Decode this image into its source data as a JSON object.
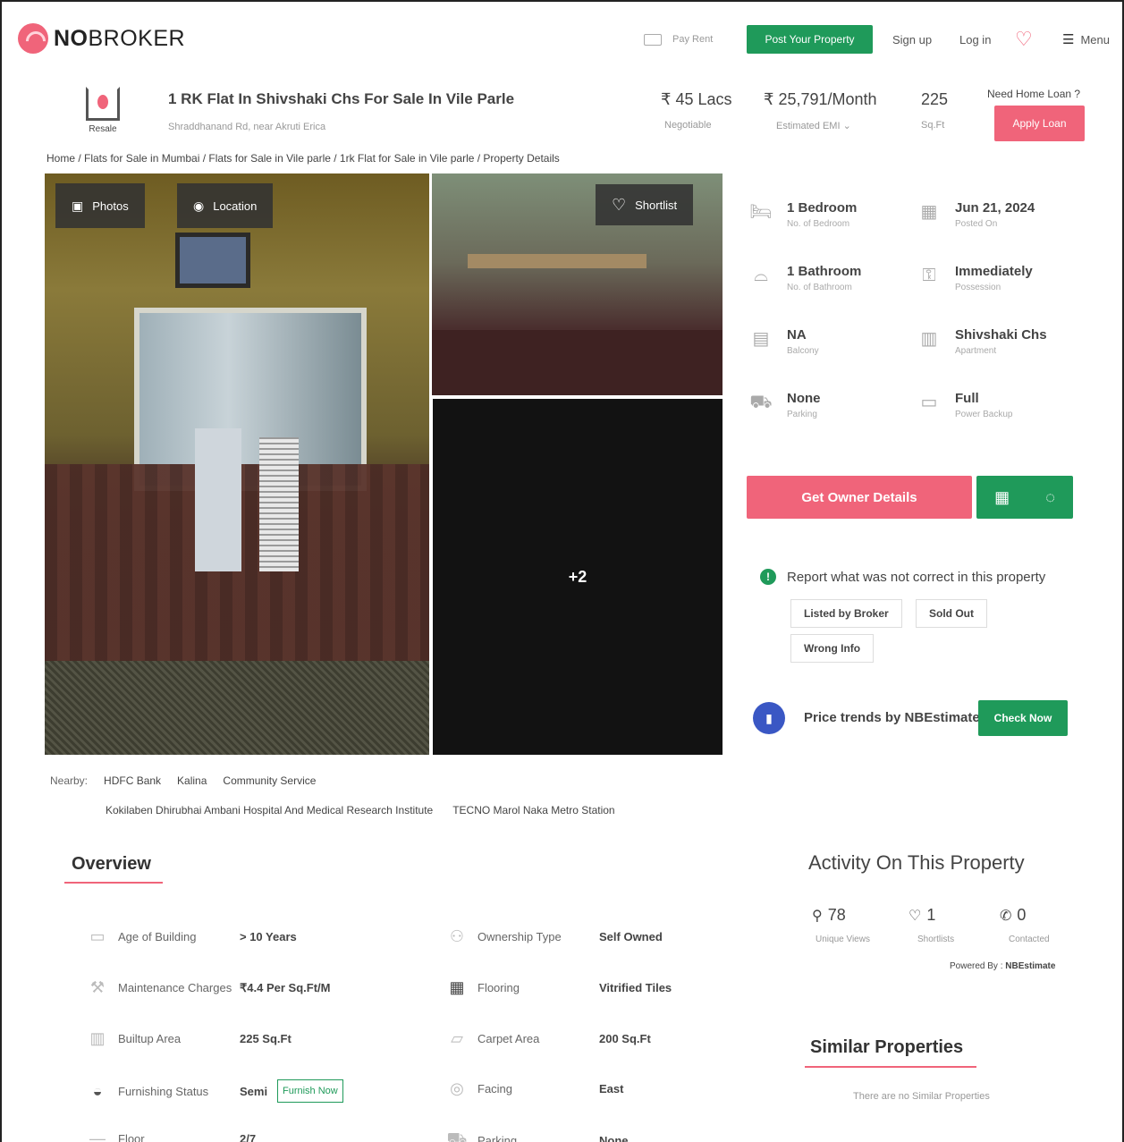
{
  "header": {
    "logo": {
      "bold": "NO",
      "rest": "BROKER"
    },
    "pay_rent": "Pay Rent",
    "post_property": "Post Your Property",
    "sign_up": "Sign up",
    "log_in": "Log in",
    "menu": "Menu"
  },
  "summary": {
    "badge": "Resale",
    "title": "1 RK Flat In Shivshaki Chs For Sale In Vile Parle",
    "address": "Shraddhanand Rd, near Akruti Erica",
    "price": "₹ 45 Lacs",
    "price_note": "Negotiable",
    "emi": "₹ 25,791/Month",
    "emi_note": "Estimated EMI",
    "area": "225",
    "area_note": "Sq.Ft",
    "loan_question": "Need Home Loan ?",
    "loan_button": "Apply Loan"
  },
  "breadcrumb": "Home / Flats for Sale in Mumbai / Flats for Sale in Vile parle / 1rk Flat for Sale in Vile parle / Property Details",
  "gallery": {
    "photos_label": "Photos",
    "location_label": "Location",
    "shortlist_label": "Shortlist",
    "more_count": "+2"
  },
  "specs": [
    {
      "icon": "bed-icon",
      "value": "1 Bedroom",
      "label": "No. of Bedroom"
    },
    {
      "icon": "calendar-icon",
      "value": "Jun 21, 2024",
      "label": "Posted On"
    },
    {
      "icon": "bath-icon",
      "value": "1 Bathroom",
      "label": "No. of Bathroom"
    },
    {
      "icon": "key-icon",
      "value": "Immediately",
      "label": "Possession"
    },
    {
      "icon": "balcony-icon",
      "value": "NA",
      "label": "Balcony"
    },
    {
      "icon": "building-icon",
      "value": "Shivshaki Chs",
      "label": "Apartment"
    },
    {
      "icon": "car-icon",
      "value": "None",
      "label": "Parking"
    },
    {
      "icon": "battery-icon",
      "value": "Full",
      "label": "Power Backup"
    }
  ],
  "owner_button": "Get Owner Details",
  "report": {
    "text": "Report what was not correct in this property",
    "tags": [
      "Listed by Broker",
      "Sold Out",
      "Wrong Info"
    ]
  },
  "price_trends": {
    "text": "Price trends by NBEstimate",
    "button": "Check Now"
  },
  "nearby": {
    "label": "Nearby:",
    "places": [
      "HDFC Bank",
      "Kalina",
      "Community Service",
      "Kokilaben Dhirubhai Ambani Hospital And Medical Research Institute",
      "TECNO Marol Naka Metro Station"
    ]
  },
  "overview": {
    "title": "Overview",
    "rows": [
      {
        "label": "Age of Building",
        "value": "> 10 Years",
        "label2": "Ownership Type",
        "value2": "Self Owned"
      },
      {
        "label": "Maintenance Charges",
        "value": "₹4.4 Per Sq.Ft/M",
        "label2": "Flooring",
        "value2": "Vitrified Tiles"
      },
      {
        "label": "Builtup Area",
        "value": "225 Sq.Ft",
        "label2": "Carpet Area",
        "value2": "200 Sq.Ft"
      },
      {
        "label": "Furnishing Status",
        "value": "Semi",
        "label2": "Facing",
        "value2": "East"
      },
      {
        "label": "Floor",
        "value": "2/7",
        "label2": "Parking",
        "value2": "None"
      }
    ],
    "furnish_button": "Furnish Now"
  },
  "activity": {
    "title": "Activity On This Property",
    "views": "78",
    "views_label": "Unique Views",
    "shortlists": "1",
    "shortlists_label": "Shortlists",
    "contacted": "0",
    "contacted_label": "Contacted",
    "powered_by_label": "Powered By :",
    "powered_by": "NBEstimate"
  },
  "similar": {
    "title": "Similar Properties",
    "empty": "There are no Similar Properties"
  },
  "colors": {
    "brand_pink": "#f0647a",
    "brand_green": "#1f9a5a"
  }
}
